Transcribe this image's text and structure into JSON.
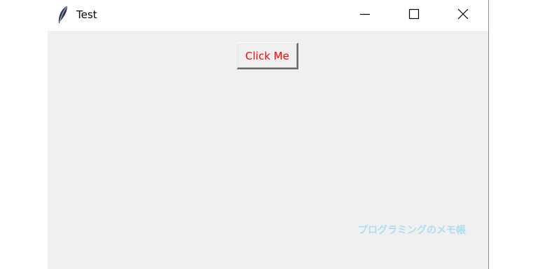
{
  "window": {
    "title": "Test",
    "icon": "feather-icon",
    "controls": [
      "minimize-icon",
      "maximize-icon",
      "close-icon"
    ]
  },
  "main": {
    "button_label": "Click Me",
    "button_text_color": "#ff0000"
  },
  "watermark": {
    "text": "プログラミングのメモ帳",
    "color": "#a9dff0"
  }
}
